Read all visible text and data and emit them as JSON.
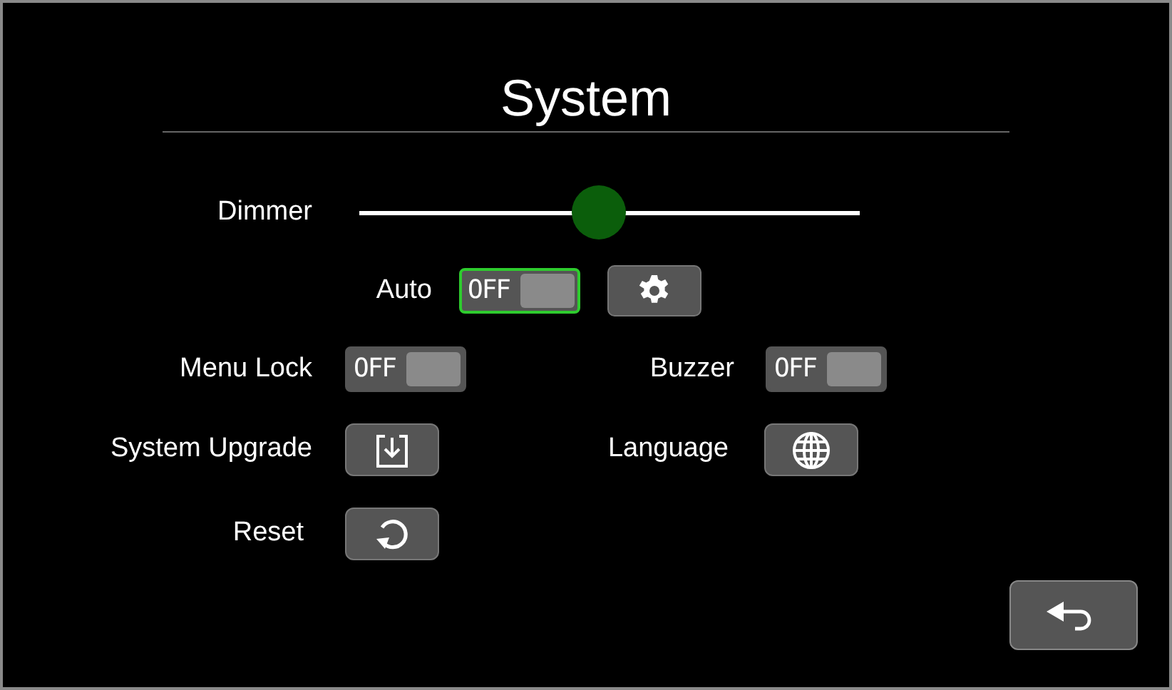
{
  "title": "System",
  "dimmer": {
    "label": "Dimmer",
    "level": 0.48
  },
  "auto": {
    "label": "Auto",
    "toggle": {
      "text": "OFF",
      "on": false,
      "focused": true
    }
  },
  "menu_lock": {
    "label": "Menu Lock",
    "toggle": {
      "text": "OFF",
      "on": false,
      "focused": false
    }
  },
  "buzzer": {
    "label": "Buzzer",
    "toggle": {
      "text": "OFF",
      "on": false,
      "focused": false
    }
  },
  "system_upgrade": {
    "label": "System Upgrade"
  },
  "language": {
    "label": "Language"
  },
  "reset": {
    "label": "Reset"
  }
}
